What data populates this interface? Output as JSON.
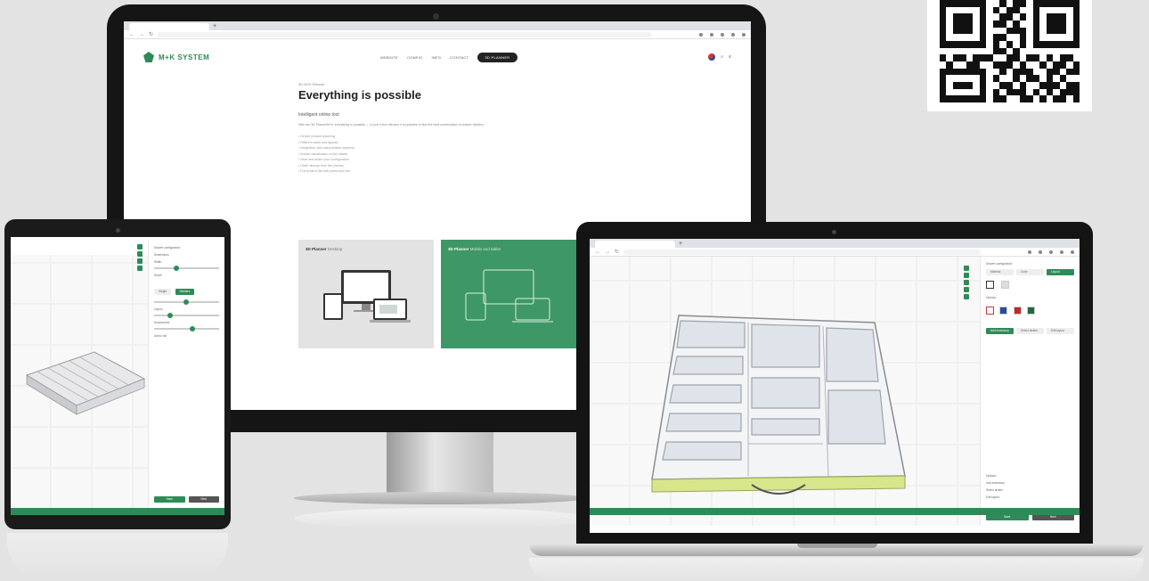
{
  "qr": {
    "rows": [
      "111111100101101111111",
      "100000101011001000001",
      "101110100110101011101",
      "101110101101001011101",
      "101110100011101011101",
      "100000101100101000001",
      "111111101010101111111",
      "000000001101000000000",
      "101101110011011010110",
      "010011001110100101101",
      "111111100101110011011",
      "100000101001011010100",
      "101110100110100111011",
      "100000101011101010111",
      "111111101100110101101"
    ]
  },
  "colors": {
    "brand_green": "#2e8b57",
    "card_green": "#3e9766"
  },
  "monitor": {
    "site": {
      "logo_text": "M+K SYSTEM",
      "nav": [
        "WEBSITE",
        "CONFIG",
        "INFO",
        "CONTACT"
      ],
      "cta": "3D PLANNER",
      "kicker": "3D M+K Planner",
      "headline": "Everything is possible",
      "subhead": "Intelligent online tool",
      "paragraph": "With the 3D PlannerM+K everything is possible — in just a few minutes it is possible to find the best combination of drawer dividers.",
      "bullets": [
        "• Simple product planning",
        "• Different sizes and layouts",
        "• Integration with many drawer systems",
        "• Instant visualization of the drawer",
        "• Save and share your configuration",
        "• Order directly from the planner",
        "• Full product list with prices and info"
      ],
      "card1": {
        "title": "3D Planner",
        "sub": "Desktop"
      },
      "card2": {
        "title": "3D Planner",
        "sub": "Mobile and tablet"
      }
    }
  },
  "tablet": {
    "panel_items": [
      "Drawer configuration",
      "Dimensions",
      "Width",
      "Depth",
      "Height",
      "Dividers",
      "Layout",
      "Accessories",
      "Add to list"
    ],
    "bottom_buttons": [
      "Save",
      "Next"
    ]
  },
  "laptop": {
    "panel_items": [
      "Drawer configuration",
      "Material",
      "Color",
      "Layout",
      "Options",
      "Add accessory",
      "Select divider",
      "Edit layout"
    ],
    "bottom_buttons": [
      "Save",
      "Next"
    ]
  }
}
